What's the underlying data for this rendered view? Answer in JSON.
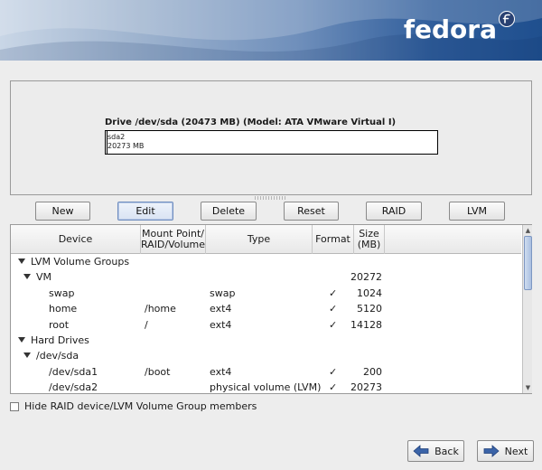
{
  "brand": {
    "name": "fedora"
  },
  "drive": {
    "title": "Drive /dev/sda (20473 MB) (Model: ATA VMware Virtual I)",
    "partition_name": "sda2",
    "partition_size": "20273 MB"
  },
  "toolbar": {
    "new_label": "New",
    "edit_label": "Edit",
    "delete_label": "Delete",
    "reset_label": "Reset",
    "raid_label": "RAID",
    "lvm_label": "LVM"
  },
  "table": {
    "columns": {
      "device": "Device",
      "mount_line1": "Mount Point/",
      "mount_line2": "RAID/Volume",
      "type": "Type",
      "format": "Format",
      "size_line1": "Size",
      "size_line2": "(MB)"
    },
    "rows": [
      {
        "device": "LVM Volume Groups",
        "mount": "",
        "type": "",
        "format": "",
        "size": "",
        "level": 0,
        "expander": true
      },
      {
        "device": "VM",
        "mount": "",
        "type": "",
        "format": "",
        "size": "20272",
        "level": 1,
        "expander": true
      },
      {
        "device": "swap",
        "mount": "",
        "type": "swap",
        "format": "✓",
        "size": "1024",
        "level": 2,
        "expander": false
      },
      {
        "device": "home",
        "mount": "/home",
        "type": "ext4",
        "format": "✓",
        "size": "5120",
        "level": 2,
        "expander": false
      },
      {
        "device": "root",
        "mount": "/",
        "type": "ext4",
        "format": "✓",
        "size": "14128",
        "level": 2,
        "expander": false
      },
      {
        "device": "Hard Drives",
        "mount": "",
        "type": "",
        "format": "",
        "size": "",
        "level": 0,
        "expander": true
      },
      {
        "device": "/dev/sda",
        "mount": "",
        "type": "",
        "format": "",
        "size": "",
        "level": 1,
        "expander": true
      },
      {
        "device": "/dev/sda1",
        "mount": "/boot",
        "type": "ext4",
        "format": "✓",
        "size": "200",
        "level": 2,
        "expander": false
      },
      {
        "device": "/dev/sda2",
        "mount": "",
        "type": "physical volume (LVM)",
        "format": "✓",
        "size": "20273",
        "level": 2,
        "expander": false
      }
    ]
  },
  "options": {
    "hide_raid_label": "Hide RAID device/LVM Volume Group members",
    "hide_raid_checked": false
  },
  "nav": {
    "back_label": "Back",
    "next_label": "Next"
  },
  "colors": {
    "banner_dark": "#1f4f8e",
    "focus_border": "#6f8dbf"
  }
}
